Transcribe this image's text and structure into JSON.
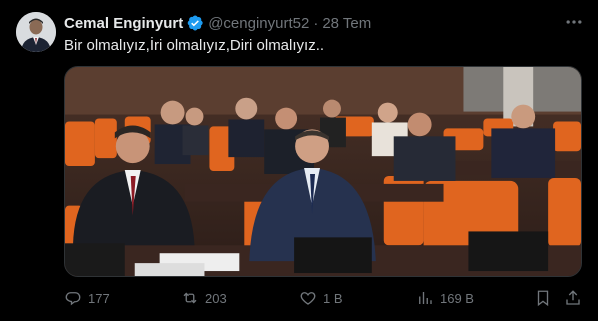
{
  "tweet": {
    "author_name": "Cemal Enginyurt",
    "handle": "@cenginyurt52",
    "separator": "·",
    "time": "28 Tem",
    "text": "Bir olmalıyız,İri olmalıyız,Diri olmalıyız..",
    "verified": true
  },
  "actions": {
    "replies": "177",
    "reposts": "203",
    "likes": "1 B",
    "views": "169 B"
  },
  "colors": {
    "background": "#000000",
    "text_primary": "#e7e9ea",
    "text_secondary": "#71767b",
    "verified_blue": "#1d9bf0",
    "border": "#2f3336"
  },
  "icons": {
    "verified": "verified-badge-icon",
    "more": "more-horizontal-icon",
    "reply": "reply-icon",
    "repost": "repost-icon",
    "like": "heart-icon",
    "views": "views-chart-icon",
    "bookmark": "bookmark-icon",
    "share": "share-icon"
  }
}
